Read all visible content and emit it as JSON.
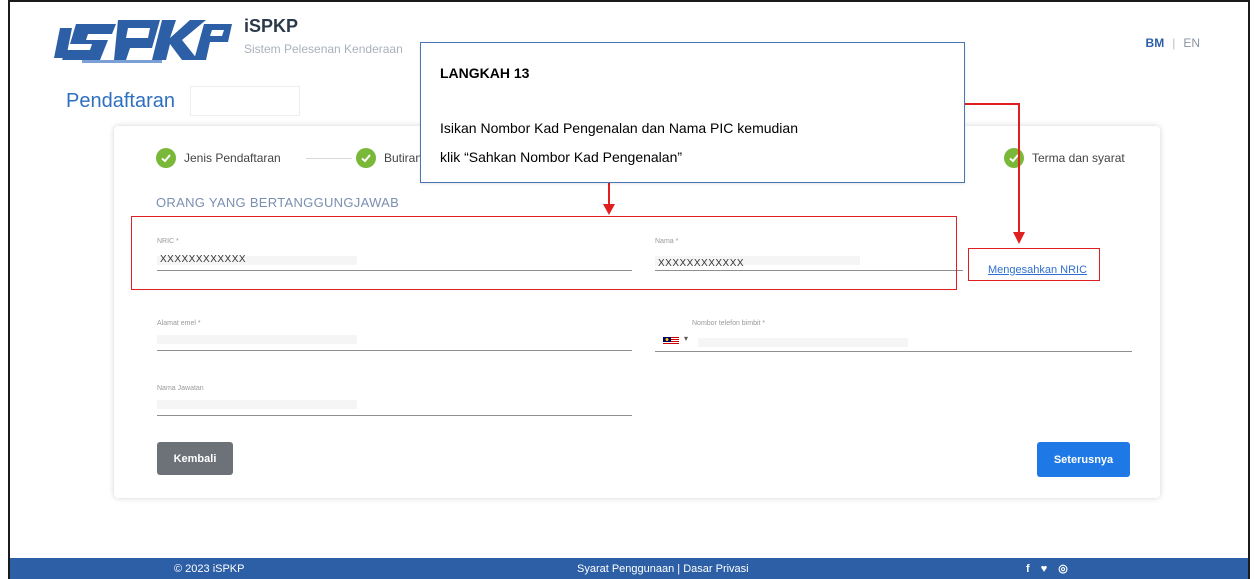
{
  "header": {
    "brand_title": "iSPKP",
    "brand_subtitle": "Sistem Pelesenan Kenderaan",
    "lang_bm": "BM",
    "lang_sep": "|",
    "lang_en": "EN"
  },
  "page": {
    "title": "Pendaftaran"
  },
  "steps": [
    {
      "label": "Jenis Pendaftaran",
      "done": true
    },
    {
      "label": "Butiran",
      "done": true
    },
    {
      "label": "Terma dan syarat",
      "done": true
    }
  ],
  "section": {
    "title": "ORANG YANG BERTANGGUNGJAWAB"
  },
  "form": {
    "nric_label": "NRIC *",
    "nric_value": "XXXXXXXXXXXX",
    "name_label": "Nama *",
    "name_value": "XXXXXXXXXXXX",
    "verify_link": "Mengesahkan NRIC",
    "email_label": "Alamat emel *",
    "phone_label": "Nombor telefon bimbit *",
    "position_label": "Nama Jawatan"
  },
  "buttons": {
    "back": "Kembali",
    "next": "Seterusnya"
  },
  "footer": {
    "copyright": "© 2023 iSPKP",
    "links": "Syarat Penggunaan | Dasar Privasi",
    "social": "f ♥ ◎"
  },
  "callout": {
    "title": "LANGKAH 13",
    "line1": "Isikan Nombor Kad Pengenalan dan Nama PIC kemudian",
    "line2": "klik “Sahkan Nombor Kad Pengenalan”"
  },
  "colors": {
    "accent": "#2d5fa6",
    "primary_button": "#1e78e6",
    "secondary_button": "#6c7278",
    "step_done": "#7ab83a",
    "annotation": "#e02020"
  }
}
